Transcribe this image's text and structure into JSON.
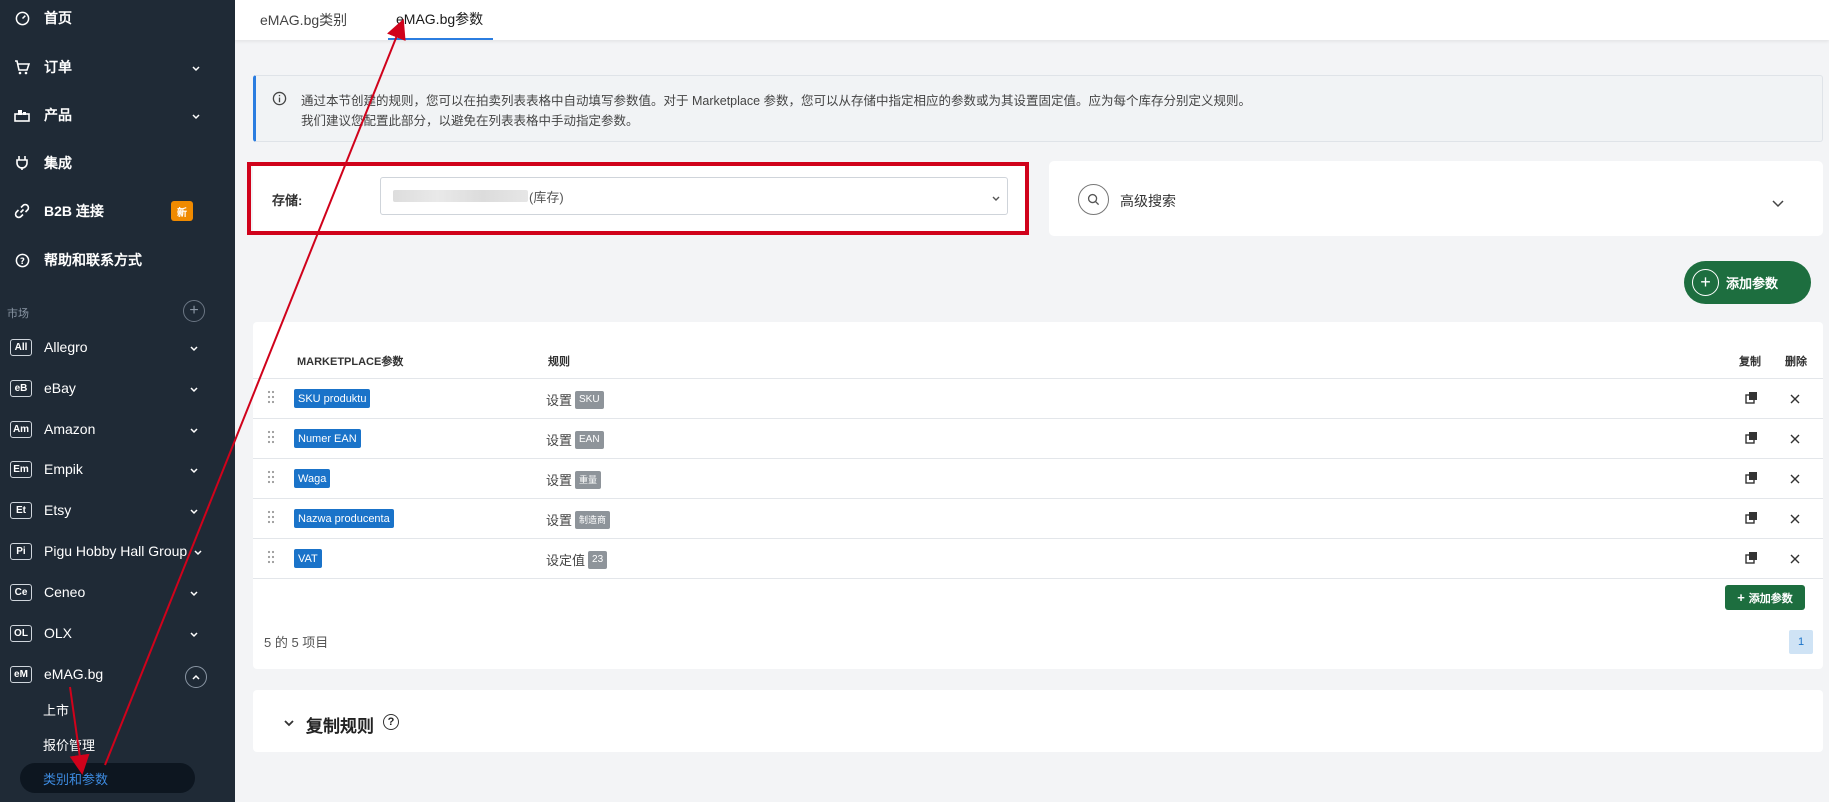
{
  "sidebar": {
    "nav": [
      {
        "label": "首页",
        "icon": "dashboard-icon"
      },
      {
        "label": "订单",
        "icon": "cart-icon"
      },
      {
        "label": "产品",
        "icon": "products-icon"
      },
      {
        "label": "集成",
        "icon": "plug-icon"
      },
      {
        "label": "B2B 连接",
        "icon": "link-icon",
        "badge": "新"
      },
      {
        "label": "帮助和联系方式",
        "icon": "help-icon"
      }
    ],
    "section_label": "市场",
    "marketplaces": [
      {
        "abbr": "All",
        "label": "Allegro"
      },
      {
        "abbr": "eB",
        "label": "eBay"
      },
      {
        "abbr": "Am",
        "label": "Amazon"
      },
      {
        "abbr": "Em",
        "label": "Empik"
      },
      {
        "abbr": "Et",
        "label": "Etsy"
      },
      {
        "abbr": "Pi",
        "label": "Pigu Hobby Hall Group"
      },
      {
        "abbr": "Ce",
        "label": "Ceneo"
      },
      {
        "abbr": "OL",
        "label": "OLX"
      },
      {
        "abbr": "eM",
        "label": "eMAG.bg"
      }
    ],
    "emag_sub": [
      "上市",
      "报价管理",
      "类别和参数"
    ]
  },
  "tabs": [
    "eMAG.bg类别",
    "eMAG.bg参数"
  ],
  "info": {
    "line1": "通过本节创建的规则，您可以在拍卖列表表格中自动填写参数值。对于 Marketplace 参数，您可以从存储中指定相应的参数或为其设置固定值。应为每个库存分别定义规则。",
    "line2": "我们建议您配置此部分，以避免在列表表格中手动指定参数。"
  },
  "storage": {
    "label": "存储:",
    "value_suffix": "(库存)"
  },
  "advanced_search": {
    "label": "高级搜索"
  },
  "add_param_label": "添加参数",
  "table": {
    "headers": {
      "param": "MARKETPLACE参数",
      "rule": "规则",
      "copy": "复制",
      "delete": "删除"
    },
    "rows": [
      {
        "param": "SKU produktu",
        "rule_text": "设置",
        "tag": "SKU"
      },
      {
        "param": "Numer EAN",
        "rule_text": "设置",
        "tag": "EAN"
      },
      {
        "param": "Waga",
        "rule_text": "设置",
        "tag": "重量"
      },
      {
        "param": "Nazwa producenta",
        "rule_text": "设置",
        "tag": "制造商"
      },
      {
        "param": "VAT",
        "rule_text": "设定值",
        "tag": "23"
      }
    ],
    "add_small_label": "添加参数",
    "count_text": "5 的 5 项目",
    "page": "1"
  },
  "copy_rules": {
    "title": "复制规则"
  },
  "colors": {
    "sidebar": "#1f2a36",
    "accent": "#2b7de0",
    "primary_green": "#1d6e3f",
    "highlight_red": "#d0021b"
  }
}
